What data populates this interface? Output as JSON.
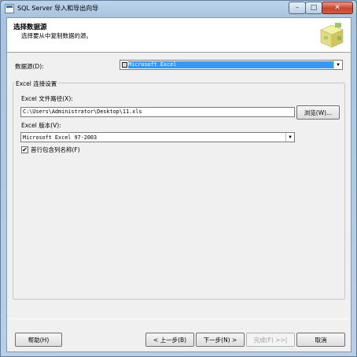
{
  "window": {
    "title": "SQL Server 导入和导出向导",
    "minimize_glyph": "–",
    "maximize_glyph": "□",
    "close_glyph": "✕"
  },
  "header": {
    "title": "选择数据源",
    "subtitle": "选择要从中复制数据的源。"
  },
  "datasource": {
    "label": "数据源(D):",
    "value": "Microsoft Excel"
  },
  "excel_group": {
    "legend": "Excel 连接设置",
    "path_label": "Excel 文件路径(X):",
    "path_value": "C:\\Users\\Administrator\\Desktop\\11.xls",
    "browse_label": "浏览(W)...",
    "version_label": "Excel 版本(V):",
    "version_value": "Microsoft Excel 97-2003",
    "first_row_label": "首行包含列名称(F)",
    "first_row_checked": true
  },
  "footer": {
    "help_label": "帮助(H)",
    "back_label": "< 上一步(B)",
    "next_label": "下一步(N) >",
    "finish_label": "完成(F) >>|",
    "cancel_label": "取消"
  },
  "colors": {
    "selection": "#3399ff",
    "close_button": "#c8452f"
  }
}
